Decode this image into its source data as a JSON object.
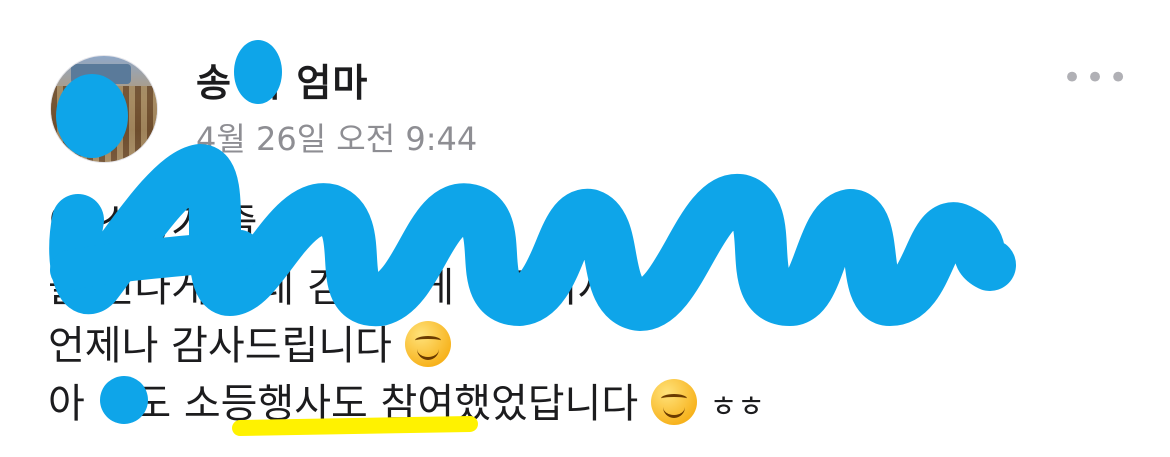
{
  "post": {
    "author": "송  이 엄마",
    "timestamp": "4월 26일 오전 9:44",
    "more_icon": "•••",
    "lines": [
      "  이         소풍가         즐     어       이",
      "              들       신나게 했네      검세하게    어주셔서",
      "언제나 감사드립니다",
      "아    이도 소등행사도 참여했었답니다"
    ],
    "suffix": "ㅎㅎ"
  },
  "colors": {
    "redaction": "#0ea5e9",
    "highlight": "#fff200",
    "secondary_text": "#8e8e93"
  },
  "icons": [
    "avatar-photo",
    "ellipsis-icon",
    "smiling-face-emoji"
  ]
}
